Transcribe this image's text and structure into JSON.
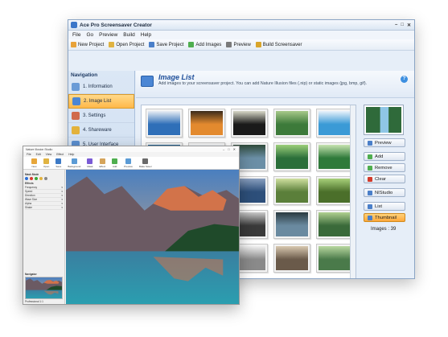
{
  "back_window": {
    "title": "Ace Pro Screensaver Creator",
    "menu": [
      "File",
      "Go",
      "Preview",
      "Build",
      "Help"
    ],
    "toolbar": [
      {
        "label": "New Project",
        "icon": "new-project-icon",
        "color": "#e8a33a"
      },
      {
        "label": "Open Project",
        "icon": "open-folder-icon",
        "color": "#e0b341"
      },
      {
        "label": "Save Project",
        "icon": "save-icon",
        "color": "#4a7fc9"
      },
      {
        "label": "Add Images",
        "icon": "add-images-icon",
        "color": "#4fae4f"
      },
      {
        "label": "Preview",
        "icon": "preview-icon",
        "color": "#7a7a7a"
      },
      {
        "label": "Build Screensaver",
        "icon": "build-icon",
        "color": "#d9a52b"
      }
    ],
    "navigation": {
      "heading": "Navigation",
      "items": [
        {
          "label": "1. Information",
          "icon": "information-icon",
          "color": "#6a9bd6",
          "active": false
        },
        {
          "label": "2. Image List",
          "icon": "image-list-icon",
          "color": "#4b86d4",
          "active": true
        },
        {
          "label": "3. Settings",
          "icon": "settings-icon",
          "color": "#d06a4c",
          "active": false
        },
        {
          "label": "4. Shareware",
          "icon": "lock-icon",
          "color": "#e3b23c",
          "active": false
        },
        {
          "label": "5. User Interface",
          "icon": "user-interface-icon",
          "color": "#5b8fcf",
          "active": false
        }
      ]
    },
    "header": {
      "title": "Image List",
      "description": "Add images to your screensaver project. You can add Nature Illusion files (.nip) or static images (jpg, bmp, gif)."
    },
    "side_buttons": [
      {
        "label": "Preview",
        "icon": "preview-icon",
        "color": "#4a7fc9",
        "selected": false
      },
      {
        "label": "Add",
        "icon": "add-icon",
        "color": "#4fae4f",
        "selected": false
      },
      {
        "label": "Remove",
        "icon": "remove-icon",
        "color": "#4fae4f",
        "selected": false
      },
      {
        "label": "Clear",
        "icon": "clear-icon",
        "color": "#d23b2b",
        "selected": false
      },
      {
        "label": "NIStudio",
        "icon": "nistudio-icon",
        "color": "#4a7fc9",
        "selected": false
      },
      {
        "label": "List",
        "icon": "list-icon",
        "color": "#4a7fc9",
        "selected": false
      },
      {
        "label": "Thumbnail",
        "icon": "thumbnail-icon",
        "color": "#4a7fc9",
        "selected": true
      }
    ],
    "images_count": "Images : 39",
    "thumbnails": [
      [
        "#2f6fb8",
        "#e9eef4"
      ],
      [
        "#e38a2e",
        "#3a2a1a"
      ],
      [
        "#1a1a1a",
        "#d8d8c8"
      ],
      [
        "#3d7a3a",
        "#a7c98a"
      ],
      [
        "#3b9ad6",
        "#eaf3fb"
      ],
      [
        "#4aa3d1",
        "#1d5e8c"
      ],
      [
        "#8fc3e8",
        "#f2f6fa"
      ],
      [
        "#6b8fa6",
        "#2f4a3a"
      ],
      [
        "#2b6f3a",
        "#9ccf7a"
      ],
      [
        "#2f7a3a",
        "#c7e3b0"
      ],
      [
        "#4d8ac7",
        "#1f3a5a"
      ],
      [
        "#7fa8c9",
        "#203040"
      ],
      [
        "#2d4f7a",
        "#8aa0c0"
      ],
      [
        "#5b7f3a",
        "#cfe0a0"
      ],
      [
        "#4b6f2a",
        "#a8d07a"
      ],
      [
        "#5a5a5a",
        "#d0d0d0"
      ],
      [
        "#7a7a7a",
        "#e2e2e2"
      ],
      [
        "#3a3a3a",
        "#c8c8c8"
      ],
      [
        "#6a8aa0",
        "#2a3a40"
      ],
      [
        "#3a6a3a",
        "#b0d090"
      ],
      [
        "#4a6a8a",
        "#dfe8f0"
      ],
      [
        "#5a7a5a",
        "#c0d8b0"
      ],
      [
        "#8a8a8a",
        "#f0f0f0"
      ],
      [
        "#6a5a4a",
        "#d8c8b0"
      ],
      [
        "#4a7a4a",
        "#b8d8a0"
      ]
    ],
    "preview_colors": [
      "#2f6a3a",
      "#8fc6e6"
    ]
  },
  "front_window": {
    "title": "Nature Illusion Studio",
    "menu": [
      "File",
      "Edit",
      "View",
      "Effect",
      "Help"
    ],
    "ribbon": [
      {
        "label": "New",
        "icon": "new-icon",
        "color": "#e7a63a"
      },
      {
        "label": "Open",
        "icon": "open-icon",
        "color": "#e0b341"
      },
      {
        "label": "Save",
        "icon": "save-icon",
        "color": "#3d7ac6"
      },
      {
        "label": "Background",
        "icon": "background-icon",
        "color": "#5b9bd5"
      },
      {
        "label": "Mask",
        "icon": "mask-icon",
        "color": "#7a5bd5"
      },
      {
        "label": "Effect",
        "icon": "effect-icon",
        "color": "#d5a45b"
      },
      {
        "label": "Add",
        "icon": "add-icon",
        "color": "#4fae4f"
      },
      {
        "label": "Preview",
        "icon": "preview-icon",
        "color": "#5b9bd5"
      },
      {
        "label": "Make Saver",
        "icon": "make-saver-icon",
        "color": "#6a6a6a"
      }
    ],
    "panel": {
      "mask_mode_label": "Mask Mode",
      "effect_label": "Effects",
      "navigator_label": "Navigator",
      "zoom_label": "Professional 1:1",
      "swatches": [
        "#2d6fd4",
        "#d43a2d",
        "#3aa83a",
        "#e3b23c",
        "#888888"
      ],
      "rows": [
        "Frequency",
        "Speed",
        "Direction",
        "Wave Size",
        "Alpha",
        "Shake"
      ]
    },
    "scene_colors": {
      "sky_top": "#4a7fbf",
      "sky_bottom": "#e9b27a",
      "mountain_far": "#6b5a63",
      "mountain_peak": "#d2734a",
      "forest": "#1f4a2a",
      "lake_top": "#3a7fa0",
      "lake_bottom": "#2a9fb0"
    }
  }
}
